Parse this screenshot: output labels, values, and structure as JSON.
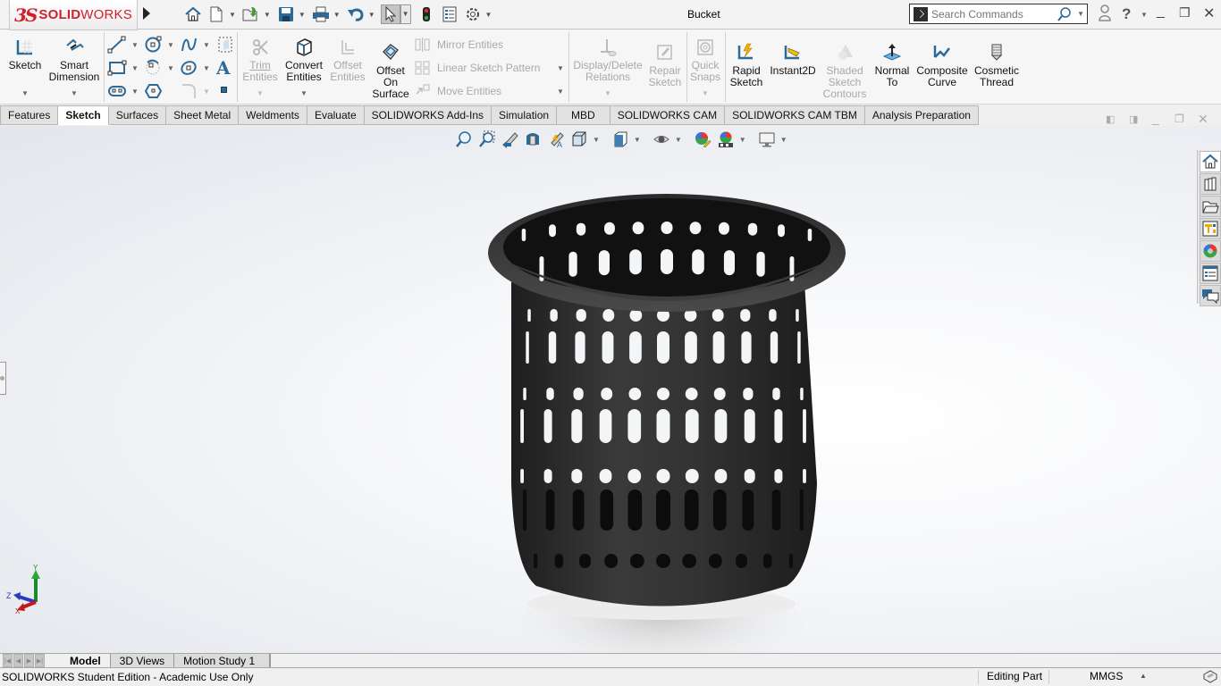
{
  "app": {
    "brand_ds": "3S",
    "brand_name_bold": "SOLID",
    "brand_name_light": "WORKS",
    "document_title": "Bucket"
  },
  "quick_access": [
    {
      "name": "home-icon"
    },
    {
      "name": "new-document-icon"
    },
    {
      "name": "open-icon"
    },
    {
      "name": "save-icon"
    },
    {
      "name": "print-icon"
    },
    {
      "name": "undo-icon"
    },
    {
      "name": "select-icon"
    },
    {
      "name": "rebuild-icon"
    },
    {
      "name": "file-properties-icon"
    },
    {
      "name": "options-icon"
    }
  ],
  "search": {
    "placeholder": "Search Commands"
  },
  "ribbon": {
    "sketch": "Sketch",
    "smart_dimension_1": "Smart",
    "smart_dimension_2": "Dimension",
    "trim_1": "Trim",
    "trim_2": "Entities",
    "convert_1": "Convert",
    "convert_2": "Entities",
    "offset_1": "Offset",
    "offset_2": "Entities",
    "offset_surface_1": "Offset",
    "offset_surface_2": "On",
    "offset_surface_3": "Surface",
    "mirror": "Mirror Entities",
    "linear_pattern": "Linear Sketch Pattern",
    "move": "Move Entities",
    "display_delete_1": "Display/Delete",
    "display_delete_2": "Relations",
    "repair_1": "Repair",
    "repair_2": "Sketch",
    "quick_snaps_1": "Quick",
    "quick_snaps_2": "Snaps",
    "rapid_1": "Rapid",
    "rapid_2": "Sketch",
    "instant2d": "Instant2D",
    "shaded_1": "Shaded",
    "shaded_2": "Sketch",
    "shaded_3": "Contours",
    "normal_1": "Normal",
    "normal_2": "To",
    "composite_1": "Composite",
    "composite_2": "Curve",
    "cosmetic_1": "Cosmetic",
    "cosmetic_2": "Thread"
  },
  "command_tabs": [
    {
      "label": "Features",
      "active": false
    },
    {
      "label": "Sketch",
      "active": true
    },
    {
      "label": "Surfaces",
      "active": false
    },
    {
      "label": "Sheet Metal",
      "active": false
    },
    {
      "label": "Weldments",
      "active": false
    },
    {
      "label": "Evaluate",
      "active": false
    },
    {
      "label": "SOLIDWORKS Add-Ins",
      "active": false
    },
    {
      "label": "Simulation",
      "active": false
    },
    {
      "label": "MBD",
      "active": false
    },
    {
      "label": "SOLIDWORKS CAM",
      "active": false
    },
    {
      "label": "SOLIDWORKS CAM TBM",
      "active": false
    },
    {
      "label": "Analysis Preparation",
      "active": false
    }
  ],
  "heads_up_toolbar": [
    "zoom-to-fit-icon",
    "zoom-to-area-icon",
    "previous-view-icon",
    "section-view-icon",
    "dynamic-annotation-views-icon",
    "view-orientation-icon",
    "display-style-icon",
    "hide-show-items-icon",
    "edit-appearance-icon",
    "apply-scene-icon",
    "view-settings-icon"
  ],
  "task_pane": [
    "solidworks-resources-icon",
    "design-library-icon",
    "file-explorer-icon",
    "view-palette-icon",
    "appearances-scenes-icon",
    "custom-properties-icon",
    "forum-icon"
  ],
  "triad": {
    "x": "X",
    "y": "Y",
    "z": "Z"
  },
  "bottom_tabs": [
    {
      "label": "Model",
      "active": true
    },
    {
      "label": "3D Views",
      "active": false
    },
    {
      "label": "Motion Study 1",
      "active": false
    }
  ],
  "status": {
    "edition": "SOLIDWORKS Student Edition - Academic Use Only",
    "mode": "Editing Part",
    "units": "MMGS"
  }
}
